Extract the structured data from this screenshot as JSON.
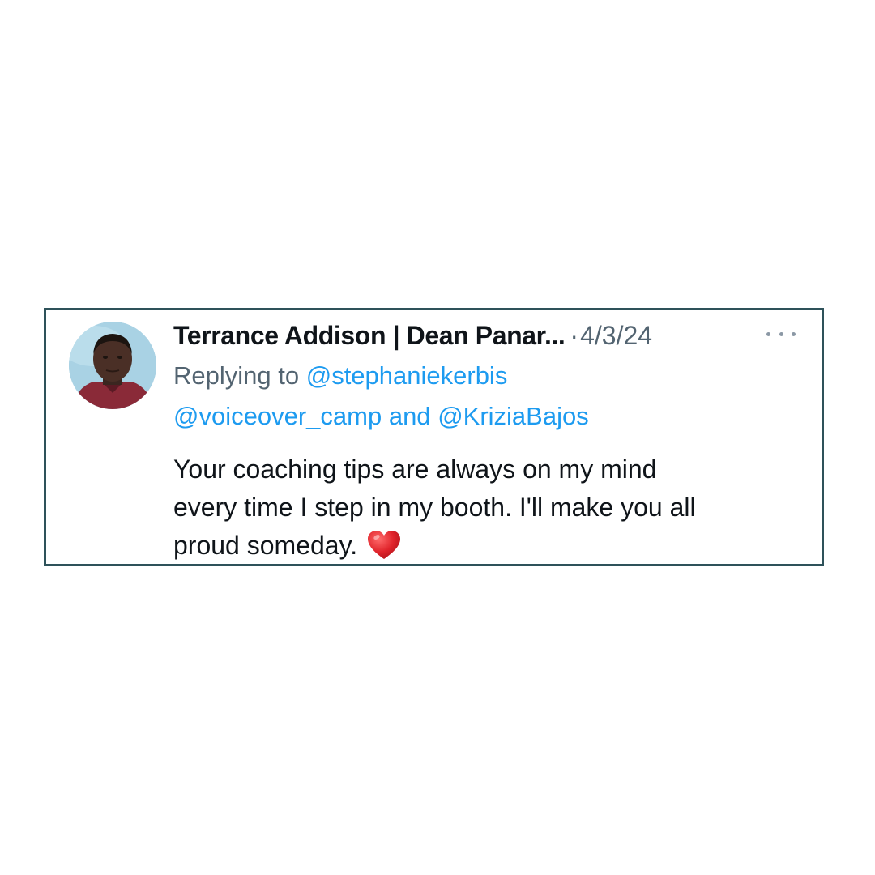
{
  "tweet": {
    "display_name": "Terrance Addison | Dean Panar...",
    "separator": "·",
    "timestamp": "4/3/24",
    "more_icon": "more-horizontal-icon",
    "reply": {
      "prefix": "Replying to",
      "mention_1": "@stephaniekerbis",
      "mention_2": "@voiceover_camp",
      "conjunction": "and",
      "mention_3": "@KriziaBajos"
    },
    "text_lines": [
      "Your coaching tips are always on my mind",
      "every time I step in my booth. I'll make you all",
      "proud someday."
    ],
    "emoji": "red-heart-icon"
  },
  "colors": {
    "card_border": "#2e525a",
    "link": "#1d9bf0",
    "secondary_text": "#536471",
    "primary_text": "#0f1419",
    "heart": "#e0242b"
  }
}
